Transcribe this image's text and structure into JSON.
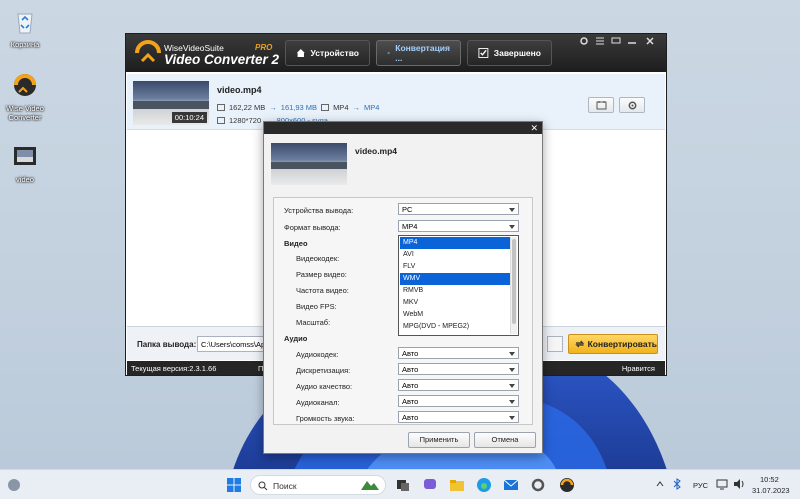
{
  "desktop": {
    "icons": [
      {
        "label": "Корзина"
      },
      {
        "label": "Wise Video Converter"
      },
      {
        "label": "video"
      }
    ]
  },
  "app": {
    "brand_small": "WiseVideoSuite",
    "brand_big": "Video Converter 2",
    "brand_pro": "PRO",
    "tabs": [
      {
        "label": "Устройство"
      },
      {
        "label": "Конвертация ..."
      },
      {
        "label": "Завершено"
      }
    ],
    "file": {
      "name": "video.mp4",
      "duration": "00:10:24",
      "size_src": "162,22 MB",
      "size_dst": "161,93 MB",
      "format_src": "MP4",
      "format_dst": "MP4",
      "res_src": "1280*720",
      "res_dst": "800x600 - svga",
      "arrow": "→"
    },
    "output": {
      "label": "Папка вывода:",
      "path": "C:\\Users\\comss\\AppD",
      "convert_label": "Конвертировать"
    },
    "status": {
      "version": "Текущая версия:2.3.1.66",
      "partial": "П",
      "like": "Нравится"
    }
  },
  "dialog": {
    "filename": "video.mp4",
    "device_label": "Устройства вывода:",
    "device_value": "PC",
    "format_label": "Формат вывода:",
    "format_value": "MP4",
    "video_section": "Видео",
    "video_fields": [
      "Видеокодек:",
      "Размер видео:",
      "Частота видео:",
      "Видео FPS:",
      "Масштаб:"
    ],
    "audio_section": "Аудио",
    "audio_fields": [
      {
        "label": "Аудиокодек:",
        "value": "Авто"
      },
      {
        "label": "Дискретизация:",
        "value": "Авто"
      },
      {
        "label": "Аудио качество:",
        "value": "Авто"
      },
      {
        "label": "Аудиоканал:",
        "value": "Авто"
      },
      {
        "label": "Громкость звука:",
        "value": "Авто"
      }
    ],
    "format_options": [
      "MP4",
      "AVI",
      "FLV",
      "WMV",
      "RMVB",
      "MKV",
      "WebM",
      "MPG(DVD - MPEG2)"
    ],
    "highlighted": [
      "MP4",
      "WMV"
    ],
    "apply_label": "Применить",
    "cancel_label": "Отмена"
  },
  "taskbar": {
    "search_placeholder": "Поиск",
    "lang": "РУС",
    "time": "10:52",
    "date": "31.07.2023"
  },
  "colors": {
    "accent": "#0a64d8",
    "convert": "#f2b21c",
    "header": "#1d1d1d"
  }
}
